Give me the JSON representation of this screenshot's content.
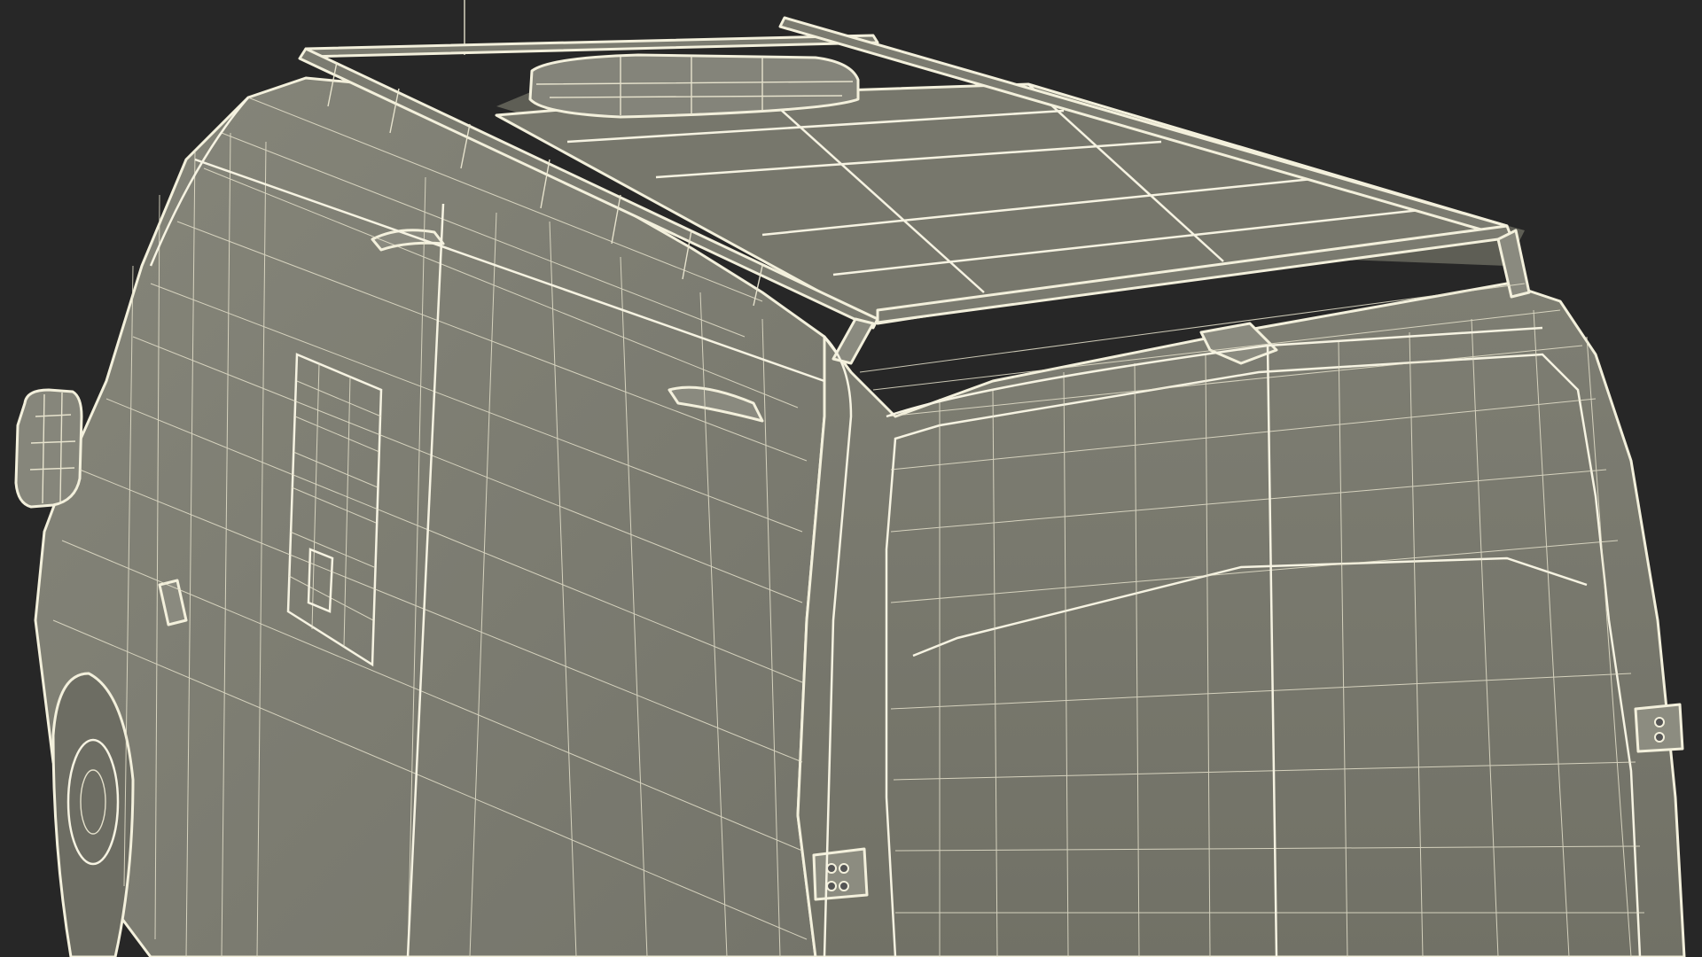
{
  "scene": {
    "subject": "wireframe-van-render",
    "background_color": "#272727",
    "surface_color": "#7d7d71",
    "roof_panel_color": "#76766b",
    "shadow_color": "#5c5c53",
    "wire_color": "#ece8d2"
  }
}
